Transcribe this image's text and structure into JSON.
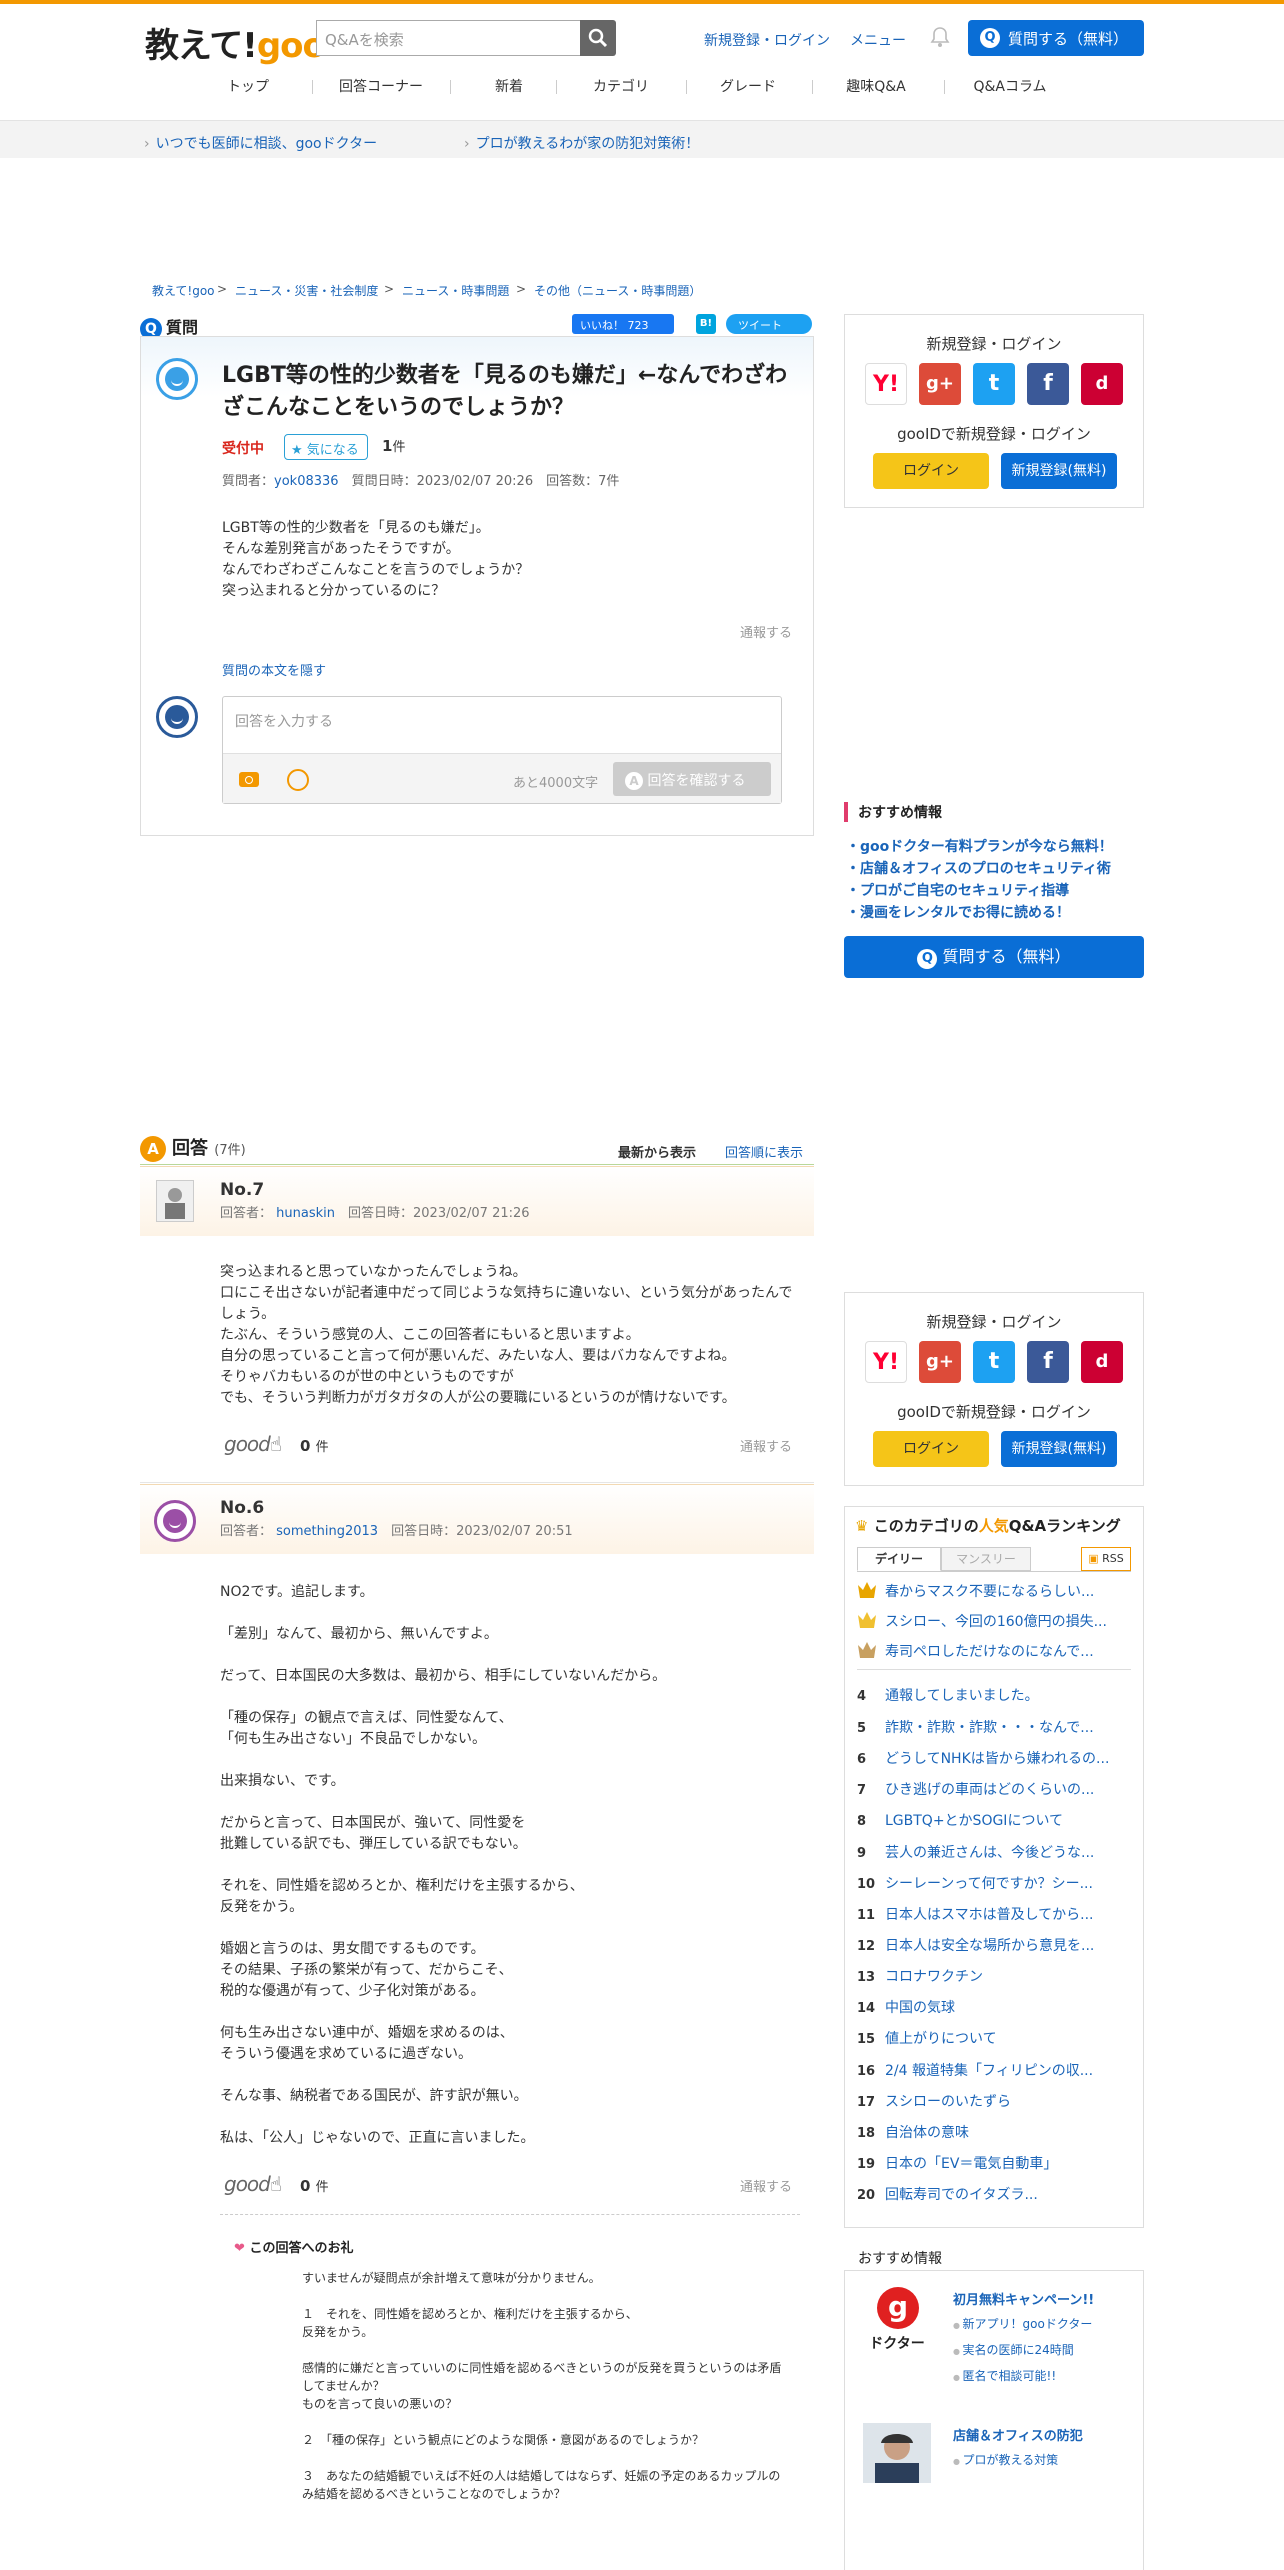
{
  "header": {
    "logo_text": "教えて!",
    "logo_goo": "goo",
    "search_placeholder": "Q&Aを検索",
    "register_login": "新規登録・ログイン",
    "menu": "メニュー",
    "ask_button": "質問する（無料）"
  },
  "nav": [
    "トップ",
    "回答コーナー",
    "新着",
    "カテゴリ",
    "グレード",
    "趣味Q&A",
    "Q&Aコラム"
  ],
  "promo": [
    "いつでも医師に相談、gooドクター",
    "プロが教えるわが家の防犯対策術！"
  ],
  "breadcrumb": [
    "教えて!goo",
    "ニュース・災害・社会制度",
    "ニュース・時事問題",
    "その他（ニュース・時事問題）"
  ],
  "question": {
    "section_label": "質問",
    "like_label": "いいね！ 723",
    "hatena_label": "B!",
    "tweet_label": "ツイート",
    "title": "LGBT等の性的少数者を「見るのも嫌だ」←なんでわざわざこんなことをいうのでしょうか？",
    "status": "受付中",
    "kininaru_label": "気になる",
    "kininaru_count": "1",
    "kininaru_unit": "件",
    "meta_asker_label": "質問者：",
    "asker": "yok08336",
    "meta_rest": "質問日時：2023/02/07 20:26　回答数：7件",
    "body": [
      "LGBT等の性的少数者を「見るのも嫌だ」。",
      "そんな差別発言があったそうですが。",
      "なんでわざわざこんなことを言うのでしょうか？",
      "突っ込まれると分かっているのに？"
    ],
    "report": "通報する",
    "hide_body": "質問の本文を隠す",
    "answer_placeholder": "回答を入力する",
    "remaining": "あと4000文字",
    "confirm_button": "回答を確認する"
  },
  "sidebar": {
    "login_title": "新規登録・ログイン",
    "goo_id_label": "gooIDで新規登録・ログイン",
    "login_button": "ログイン",
    "register_button": "新規登録(無料)",
    "sns": {
      "yahoo": "Y!",
      "google": "g+",
      "twitter": "t",
      "facebook": "f",
      "docomo": "d"
    },
    "rec_title": "おすすめ情報",
    "rec_links": [
      "・gooドクター有料プランが今なら無料！",
      "・店舗＆オフィスのプロのセキュリティ術",
      "・プロがご自宅のセキュリティ指導",
      "・漫画をレンタルでお得に読める！"
    ],
    "ask_button": "質問する（無料）"
  },
  "answers_head": {
    "label": "回答",
    "count": "(7件)",
    "sort_new": "最新から表示",
    "sort_old": "回答順に表示"
  },
  "answers": [
    {
      "no": "No.7",
      "answerer_label": "回答者：",
      "answerer": "hunaskin",
      "date": "回答日時：2023/02/07 21:26",
      "body": "突っ込まれると思っていなかったんでしょうね。\n口にこそ出さないが記者連中だって同じような気持ちに違いない、という気分があったんでしょう。\nたぶん、そういう感覚の人、ここの回答者にもいると思いますよ。\n自分の思っていること言って何が悪いんだ、みたいな人、要はバカなんですよね。\nそりゃバカもいるのが世の中というものですが\nでも、そういう判断力がガタガタの人が公の要職にいるというのが情けないです。",
      "good": "good",
      "good_count": "0",
      "good_unit": "件",
      "report": "通報する"
    },
    {
      "no": "No.6",
      "answerer_label": "回答者：",
      "answerer": "something2013",
      "date": "回答日時：2023/02/07 20:51",
      "body": "NO2です。追記します。\n\n「差別」なんて、最初から、無いんですよ。\n\nだって、日本国民の大多数は、最初から、相手にしていないんだから。\n\n「種の保存」の観点で言えば、同性愛なんて、\n「何も生み出さない」不良品でしかない。\n\n出来損ない、です。\n\nだからと言って、日本国民が、強いて、同性愛を\n批難している訳でも、弾圧している訳でもない。\n\nそれを、同性婚を認めろとか、権利だけを主張するから、\n反発をかう。\n\n婚姻と言うのは、男女間でするものです。\nその結果、子孫の繁栄が有って、だからこそ、\n税的な優遇が有って、少子化対策がある。\n\n何も生み出さない連中が、婚姻を求めるのは、\nそういう優遇を求めているに過ぎない。\n\nそんな事、納税者である国民が、許す訳が無い。\n\n私は、「公人」じゃないので、正直に言いました。",
      "good": "good",
      "good_count": "0",
      "good_unit": "件",
      "report": "通報する"
    }
  ],
  "feedback": {
    "title": "この回答へのお礼",
    "body": "すいませんが疑問点が余計増えて意味が分かりません。\n\n１　それを、同性婚を認めろとか、権利だけを主張するから、\n反発をかう。\n\n感情的に嫌だと言っていいのに同性婚を認めるべきというのが反発を買うというのは矛盾してませんか？\nものを言って良いの悪いの？\n\n２　「種の保存」という観点にどのような関係・意図があるのでしょうか？\n\n３　あなたの結婚観でいえば不妊の人は結婚してはならず、妊娠の予定のあるカップルのみ結婚を認めるべきということなのでしょうか？"
  },
  "ranking": {
    "title_pre": "このカテゴリの",
    "title_hl": "人気",
    "title_post": "Q&Aランキング",
    "tab_daily": "デイリー",
    "tab_monthly": "マンスリー",
    "rss": "RSS",
    "items": [
      {
        "n": "1",
        "t": "春からマスク不要になるらしい..."
      },
      {
        "n": "2",
        "t": "スシロー、今回の160億円の損失..."
      },
      {
        "n": "3",
        "t": "寿司ペロしただけなのになんで..."
      },
      {
        "n": "4",
        "t": "通報してしまいました。"
      },
      {
        "n": "5",
        "t": "詐欺・詐欺・詐欺・・・なんで..."
      },
      {
        "n": "6",
        "t": "どうしてNHKは皆から嫌われるの..."
      },
      {
        "n": "7",
        "t": "ひき逃げの車両はどのくらいの..."
      },
      {
        "n": "8",
        "t": "LGBTQ+とかSOGIについて"
      },
      {
        "n": "9",
        "t": "芸人の兼近さんは、今後どうな..."
      },
      {
        "n": "10",
        "t": "シーレーンって何ですか？シー..."
      },
      {
        "n": "11",
        "t": "日本人はスマホは普及してから..."
      },
      {
        "n": "12",
        "t": "日本人は安全な場所から意見を..."
      },
      {
        "n": "13",
        "t": "コロナワクチン"
      },
      {
        "n": "14",
        "t": "中国の気球"
      },
      {
        "n": "15",
        "t": "値上がりについて"
      },
      {
        "n": "16",
        "t": "2/4 報道特集「フィリピンの収..."
      },
      {
        "n": "17",
        "t": "スシローのいたずら"
      },
      {
        "n": "18",
        "t": "自治体の意味"
      },
      {
        "n": "19",
        "t": "日本の「EV＝電気自動車」"
      },
      {
        "n": "20",
        "t": "回転寿司でのイタズラ..."
      }
    ],
    "crown_colors": [
      "#e8a500",
      "#f0c030",
      "#c8a060"
    ]
  },
  "rec2": {
    "title": "おすすめ情報",
    "doc_logo": "ドクター",
    "doc_title": "初月無料キャンペーン!!",
    "doc_items": [
      "新アプリ！gooドクター",
      "実名の医師に24時間",
      "匿名で相談可能!!"
    ],
    "sec_title": "店舗＆オフィスの防犯",
    "sec_items": [
      "プロが教える対策"
    ]
  }
}
